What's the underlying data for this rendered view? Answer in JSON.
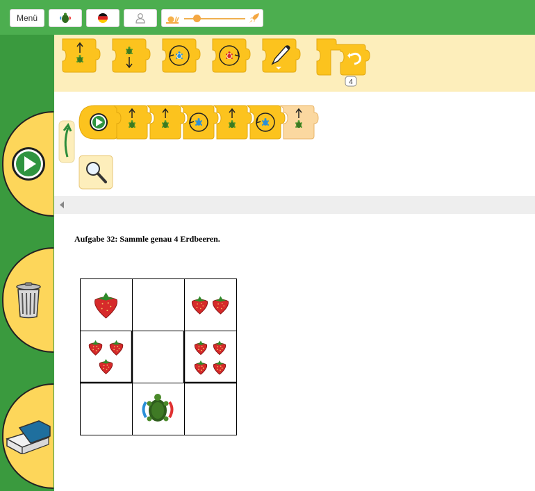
{
  "topbar": {
    "menu_label": "Menü",
    "icons": [
      "turtle-icon",
      "german-flag-icon",
      "user-icon",
      "snail-speed-icon",
      "rocket-speed-icon"
    ],
    "speed_slider": {
      "value": 0.2
    }
  },
  "toolbox": {
    "blocks": [
      "turtle-forward",
      "turtle-backward",
      "turn-left",
      "turn-right",
      "pen",
      "repeat"
    ],
    "repeat_count": "4"
  },
  "program": {
    "blocks": [
      "start",
      "forward",
      "forward",
      "turn-left",
      "forward",
      "turn-left",
      "forward"
    ]
  },
  "sidebar": {
    "buttons": [
      "run",
      "trash",
      "eraser"
    ]
  },
  "task": {
    "text": "Aufgabe 32: Sammle genau 4 Erdbeeren."
  },
  "grid": {
    "rows": 3,
    "cols": 3,
    "strawberries": [
      [
        1,
        0,
        2
      ],
      [
        3,
        0,
        4
      ],
      [
        0,
        0,
        0
      ]
    ],
    "turtle": {
      "row": 2,
      "col": 1
    }
  },
  "colors": {
    "topbar": "#4cae4f",
    "sidebar": "#3a9a3e",
    "block": "#fcc31e",
    "toolbox_bg": "#fdeebb"
  }
}
